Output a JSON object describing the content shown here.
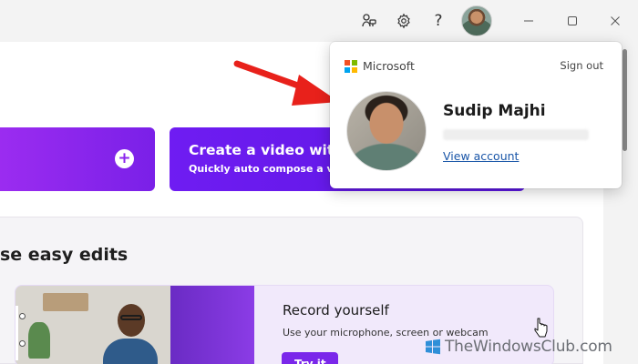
{
  "titlebar": {
    "icons": [
      "connect-icon",
      "gear-icon",
      "help-icon",
      "minimize-icon",
      "maximize-icon",
      "close-icon"
    ],
    "help_glyph": "?"
  },
  "actions": {
    "record_card_icon": "+",
    "ai_card_title": "Create a video with A",
    "ai_card_subtitle": "Quickly auto compose a vide"
  },
  "edits": {
    "heading": "se easy edits",
    "feature": {
      "title": "Record yourself",
      "subtitle": "Use your microphone, screen or webcam",
      "button_label": "Try it"
    }
  },
  "account_flyout": {
    "brand": "Microsoft",
    "sign_out_label": "Sign out",
    "user_name": "Sudip Majhi",
    "view_account_label": "View account",
    "ms_logo_colors": [
      "#f25022",
      "#7fba00",
      "#00a4ef",
      "#ffb900"
    ]
  },
  "watermark": {
    "text": "TheWindowsClub.com"
  },
  "colors": {
    "accent_purple": "#7a27ea",
    "arrow_red": "#e8211b",
    "link_blue": "#1a56a8"
  }
}
